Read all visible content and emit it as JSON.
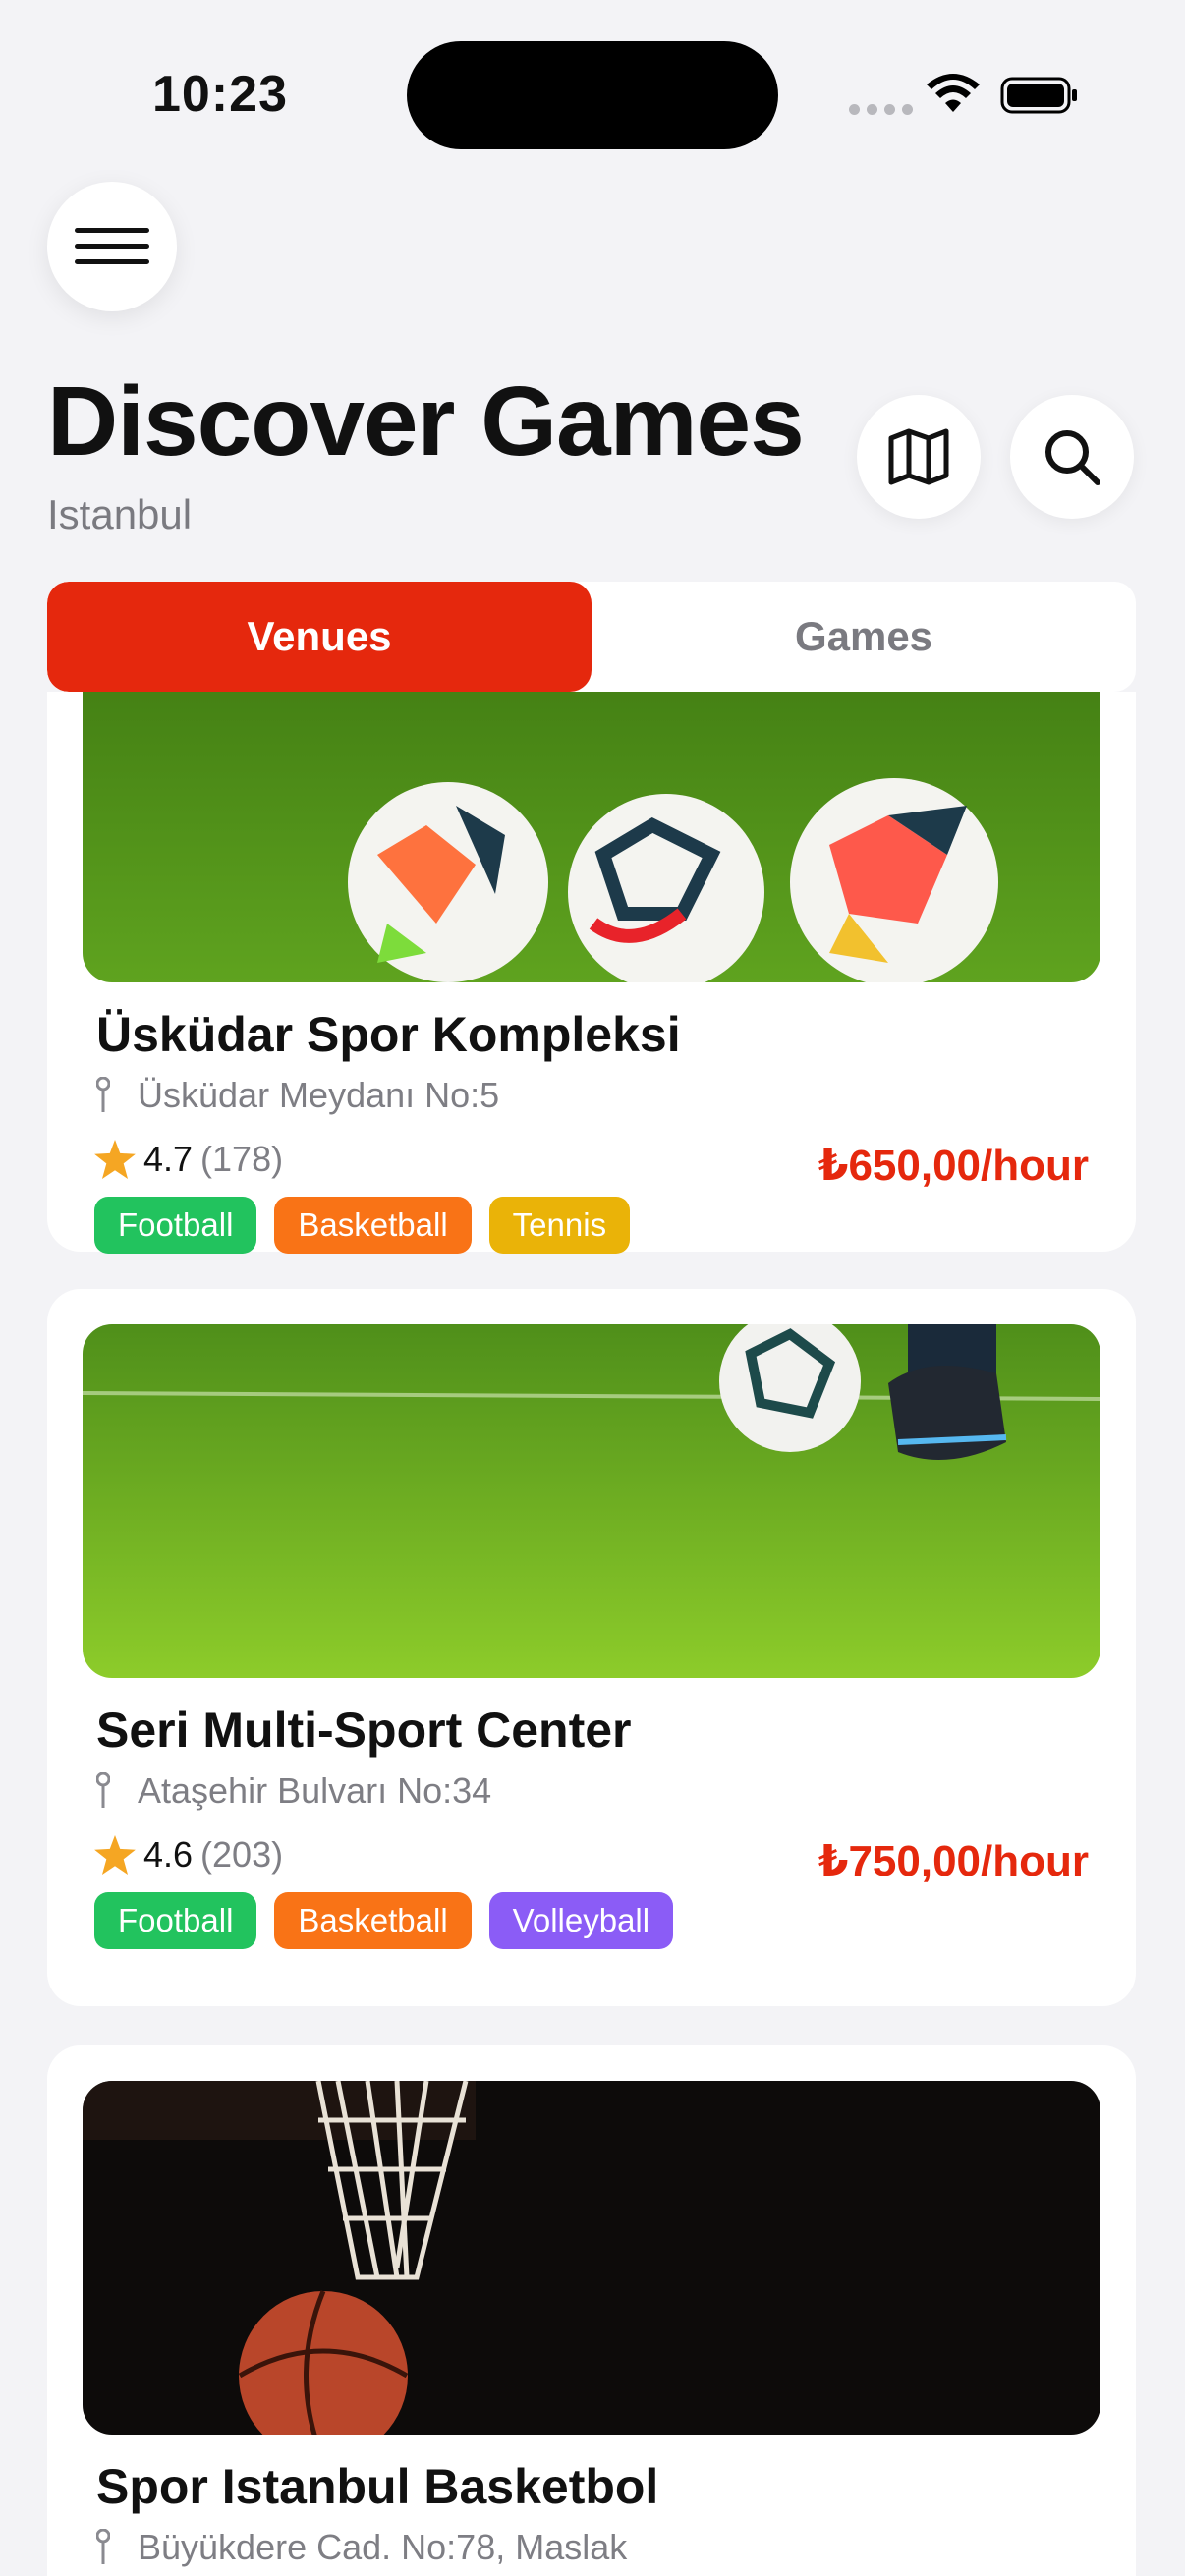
{
  "status_bar": {
    "time": "10:23"
  },
  "header": {
    "title": "Discover Games",
    "location": "Istanbul"
  },
  "segments": {
    "venues": "Venues",
    "games": "Games"
  },
  "colors": {
    "accent": "#e5280d",
    "football": "#22c35e",
    "basketball": "#f97316",
    "tennis": "#eab308",
    "volleyball": "#8b5cf6"
  },
  "venues": [
    {
      "name": "Üsküdar Spor Kompleksi",
      "address": "Üsküdar Meydanı No:5",
      "rating": "4.7",
      "reviews": "(178)",
      "price": "₺650,00/hour",
      "tags": [
        "Football",
        "Basketball",
        "Tennis"
      ]
    },
    {
      "name": "Seri Multi-Sport Center",
      "address": "Ataşehir Bulvarı No:34",
      "rating": "4.6",
      "reviews": "(203)",
      "price": "₺750,00/hour",
      "tags": [
        "Football",
        "Basketball",
        "Volleyball"
      ]
    },
    {
      "name": "Spor Istanbul Basketbol",
      "address": "Büyükdere Cad. No:78, Maslak"
    }
  ]
}
